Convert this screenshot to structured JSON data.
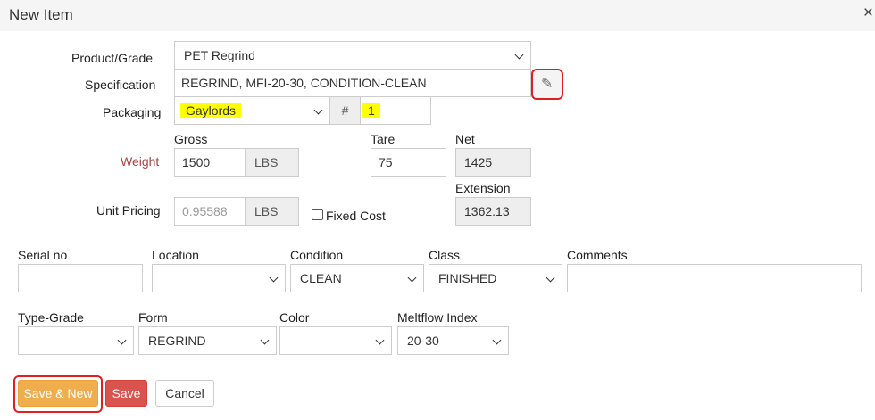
{
  "dialog": {
    "title": "New Item",
    "close_glyph": "×"
  },
  "product_grade": {
    "label": "Product/Grade",
    "value": "PET Regrind"
  },
  "specification": {
    "label": "Specification",
    "value": "REGRIND, MFI-20-30, CONDITION-CLEAN",
    "edit_icon": "pencil-icon"
  },
  "packaging": {
    "label": "Packaging",
    "value": "Gaylords",
    "count_prefix": "#",
    "count": "1"
  },
  "weight": {
    "label": "Weight",
    "gross_label": "Gross",
    "gross": "1500",
    "gross_unit": "LBS",
    "tare_label": "Tare",
    "tare": "75",
    "net_label": "Net",
    "net": "1425"
  },
  "unit_pricing": {
    "label": "Unit Pricing",
    "price": "0.95588",
    "unit": "LBS",
    "fixed_cost_label": "Fixed Cost",
    "fixed_cost_checked": false,
    "extension_label": "Extension",
    "extension": "1362.13"
  },
  "row1": {
    "serial_label": "Serial no",
    "serial_value": "",
    "location_label": "Location",
    "location_value": "",
    "condition_label": "Condition",
    "condition_value": "CLEAN",
    "class_label": "Class",
    "class_value": "FINISHED",
    "comments_label": "Comments",
    "comments_value": ""
  },
  "row2": {
    "type_grade_label": "Type-Grade",
    "type_grade_value": "",
    "form_label": "Form",
    "form_value": "REGRIND",
    "color_label": "Color",
    "color_value": "",
    "meltflow_label": "Meltflow Index",
    "meltflow_value": "20-30"
  },
  "buttons": {
    "save_new": "Save & New",
    "save": "Save",
    "cancel": "Cancel"
  },
  "colors": {
    "save_new": "#f0ad4e",
    "save": "#d9534f",
    "highlight": "#ffff00",
    "annotation": "#e02020",
    "weight_label": "#a94442"
  }
}
